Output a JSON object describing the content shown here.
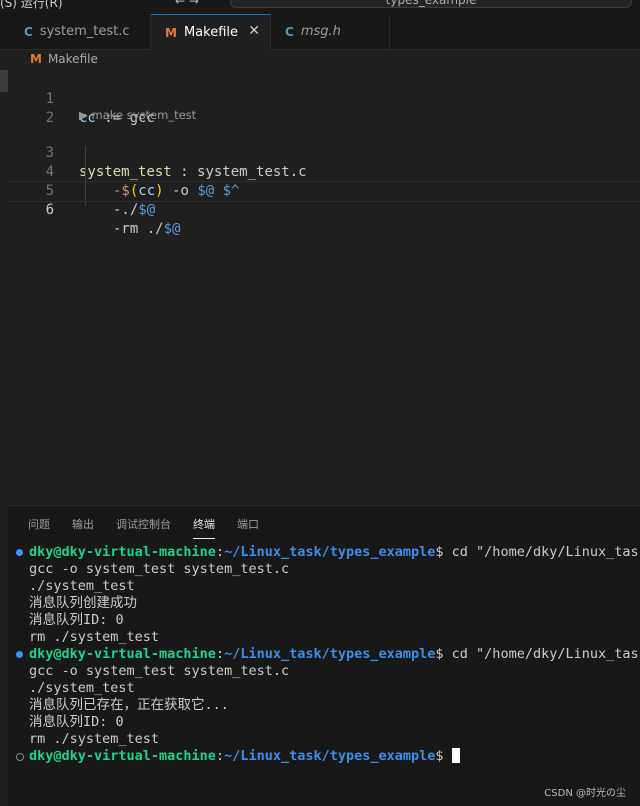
{
  "topbar": {
    "menu": "(S)   运行(R)",
    "nav": "← →",
    "command_center": "types_example"
  },
  "tabs": [
    {
      "icon": "C",
      "label": "system_test.c"
    },
    {
      "icon": "M",
      "label": "Makefile",
      "close": "✕"
    },
    {
      "icon": "C",
      "label": "msg.h"
    }
  ],
  "breadcrumb": {
    "icon": "M",
    "label": "Makefile"
  },
  "editor": {
    "codelens": "make system_test",
    "lines": {
      "l1": {
        "num": "1",
        "a": "cc",
        "b": " := ",
        "c": "gcc"
      },
      "l2": {
        "num": "2"
      },
      "l3": {
        "num": "3",
        "a": "system_test",
        "b": " : ",
        "c": "system_test.c"
      },
      "l4": {
        "num": "4",
        "a": "-$",
        "b": "(",
        "c": "cc",
        "d": ")",
        "e": " -o ",
        "f": "$@ $^"
      },
      "l5": {
        "num": "5",
        "a": "-./",
        "b": "$@"
      },
      "l6": {
        "num": "6",
        "a": "-rm ./",
        "b": "$@"
      }
    }
  },
  "panel": {
    "tabs": [
      "问题",
      "输出",
      "调试控制台",
      "终端",
      "端口"
    ],
    "terminal": {
      "user": "dky@dky-virtual-machine",
      "sep": ":",
      "path": "~/Linux_task/types_example",
      "prompt": "$ ",
      "cmd1": "cd \"/home/dky/Linux_task/types_example/\" && make",
      "out1": [
        "gcc -o system_test system_test.c",
        "./system_test",
        "消息队列创建成功",
        "消息队列ID: 0",
        "rm ./system_test"
      ],
      "out2": [
        "gcc -o system_test system_test.c",
        "./system_test",
        "消息队列已存在，正在获取它...",
        "消息队列ID: 0",
        "rm ./system_test"
      ]
    }
  },
  "watermark": "CSDN @时光の尘"
}
